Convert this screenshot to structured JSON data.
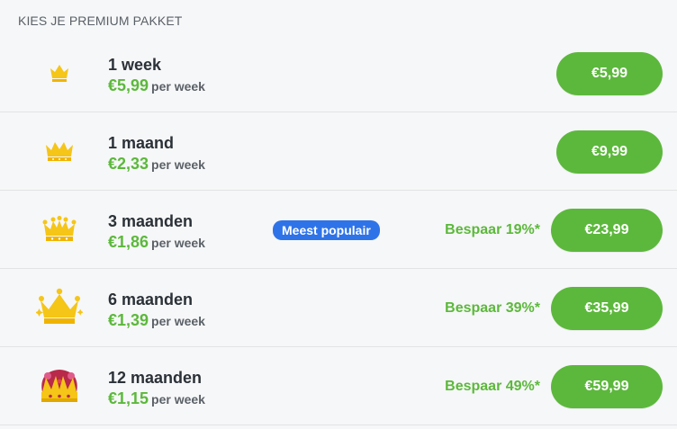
{
  "section_title": "KIES JE PREMIUM PAKKET",
  "packages": [
    {
      "name": "1 week",
      "price": "€5,99",
      "per": "per week",
      "badge": "",
      "savings": "",
      "button": "€5,99",
      "crown": "crown-small-icon"
    },
    {
      "name": "1 maand",
      "price": "€2,33",
      "per": "per week",
      "badge": "",
      "savings": "",
      "button": "€9,99",
      "crown": "crown-medium-icon"
    },
    {
      "name": "3 maanden",
      "price": "€1,86",
      "per": "per week",
      "badge": "Meest populair",
      "savings": "Bespaar 19%*",
      "button": "€23,99",
      "crown": "crown-large-icon"
    },
    {
      "name": "6 maanden",
      "price": "€1,39",
      "per": "per week",
      "badge": "",
      "savings": "Bespaar 39%*",
      "button": "€35,99",
      "crown": "crown-sparkle-icon"
    },
    {
      "name": "12 maanden",
      "price": "€1,15",
      "per": "per week",
      "badge": "",
      "savings": "Bespaar 49%*",
      "button": "€59,99",
      "crown": "crown-royal-icon"
    }
  ],
  "colors": {
    "accent_green": "#5cb83c",
    "badge_blue": "#2f73e8",
    "crown_gold": "#f5c518",
    "royal_red": "#b8294a"
  }
}
